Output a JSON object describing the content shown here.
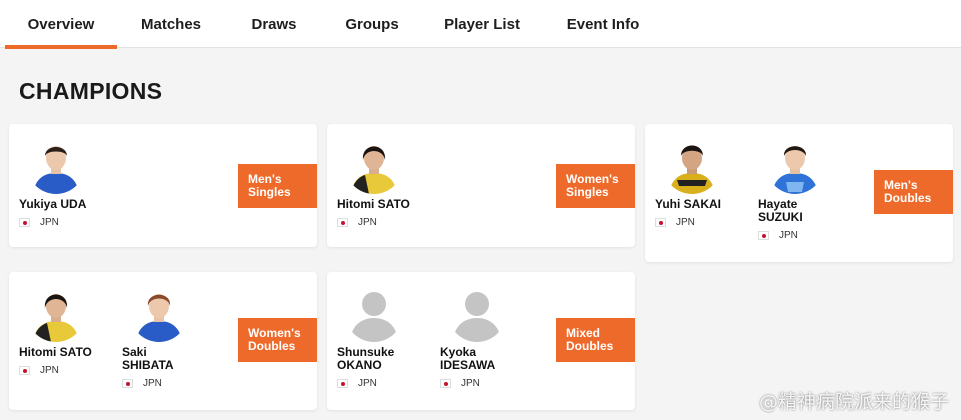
{
  "tabs": [
    {
      "label": "Overview",
      "active": true
    },
    {
      "label": "Matches",
      "active": false
    },
    {
      "label": "Draws",
      "active": false
    },
    {
      "label": "Groups",
      "active": false
    },
    {
      "label": "Player List",
      "active": false
    },
    {
      "label": "Event Info",
      "active": false
    }
  ],
  "section_title": "CHAMPIONS",
  "accent_color": "#ee6a2a",
  "champions": [
    {
      "event_line1": "Men's",
      "event_line2": "Singles",
      "players": [
        {
          "name_line1": "Yukiya UDA",
          "name_line2": "",
          "country": "JPN",
          "photo": "player-photo",
          "jersey_color": "#2a5cc8"
        }
      ]
    },
    {
      "event_line1": "Women's",
      "event_line2": "Singles",
      "players": [
        {
          "name_line1": "Hitomi SATO",
          "name_line2": "",
          "country": "JPN",
          "photo": "player-photo",
          "jersey_color": "#e8c93a"
        }
      ]
    },
    {
      "event_line1": "Men's",
      "event_line2": "Doubles",
      "players": [
        {
          "name_line1": "Yuhi SAKAI",
          "name_line2": "",
          "country": "JPN",
          "photo": "player-photo",
          "jersey_color": "#d9b01c"
        },
        {
          "name_line1": "Hayate",
          "name_line2": "SUZUKI",
          "country": "JPN",
          "photo": "player-photo",
          "jersey_color": "#2f72d8"
        }
      ]
    },
    {
      "event_line1": "Women's",
      "event_line2": "Doubles",
      "players": [
        {
          "name_line1": "Hitomi SATO",
          "name_line2": "",
          "country": "JPN",
          "photo": "player-photo",
          "jersey_color": "#e8c93a"
        },
        {
          "name_line1": "Saki",
          "name_line2": "SHIBATA",
          "country": "JPN",
          "photo": "player-photo",
          "jersey_color": "#2a5cc8"
        }
      ]
    },
    {
      "event_line1": "Mixed",
      "event_line2": "Doubles",
      "players": [
        {
          "name_line1": "Shunsuke",
          "name_line2": "OKANO",
          "country": "JPN",
          "photo": "placeholder-avatar",
          "jersey_color": "#c8c8c8"
        },
        {
          "name_line1": "Kyoka",
          "name_line2": "IDESAWA",
          "country": "JPN",
          "photo": "placeholder-avatar",
          "jersey_color": "#c8c8c8"
        }
      ]
    }
  ],
  "watermark": "@精神病院派来的猴子"
}
